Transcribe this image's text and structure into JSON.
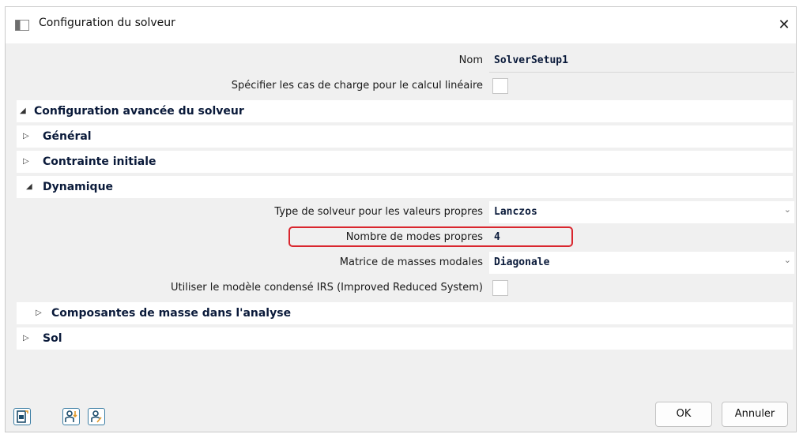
{
  "window": {
    "title": "Configuration du solveur",
    "close_glyph": "✕"
  },
  "fields": {
    "nom": {
      "label": "Nom",
      "value": "SolverSetup1"
    },
    "specifier": {
      "label": "Spécifier les cas de charge pour le calcul linéaire",
      "checked": false
    },
    "type_solveur": {
      "label": "Type de solveur pour les valeurs propres",
      "value": "Lanczos"
    },
    "nombre_modes": {
      "label": "Nombre de modes propres",
      "value": "4"
    },
    "matrice": {
      "label": "Matrice de masses modales",
      "value": "Diagonale"
    },
    "irs": {
      "label": "Utiliser le modèle condensé IRS (Improved Reduced System)",
      "checked": false
    }
  },
  "sections": {
    "config_avancee": {
      "label": "Configuration avancée du solveur",
      "expanded": true
    },
    "general": {
      "label": "Général",
      "expanded": false
    },
    "contrainte": {
      "label": "Contrainte initiale",
      "expanded": false
    },
    "dynamique": {
      "label": "Dynamique",
      "expanded": true
    },
    "composantes": {
      "label": "Composantes de masse dans l'analyse",
      "expanded": false
    },
    "sol": {
      "label": "Sol",
      "expanded": false
    }
  },
  "glyphs": {
    "expanded": "◢",
    "collapsed": "▷",
    "dropdown": "⌄"
  },
  "buttons": {
    "ok": "OK",
    "cancel": "Annuler"
  },
  "icons": {
    "title": "window-icon",
    "footer": [
      "export-document-icon",
      "sort-users-icon",
      "user-filter-icon"
    ]
  },
  "colors": {
    "highlight": "#d9262e",
    "accent": "#3c7ea4"
  }
}
